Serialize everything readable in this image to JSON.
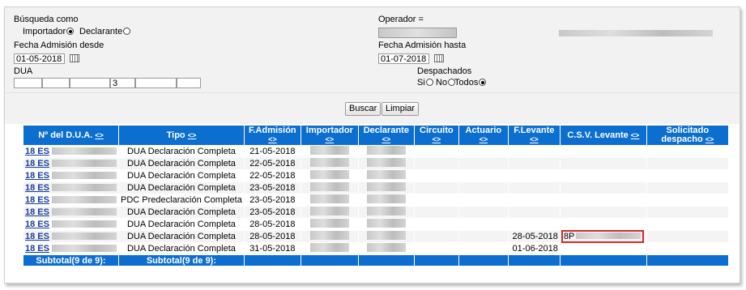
{
  "filters": {
    "busqueda_label": "Búsqueda como",
    "importador_label": "Importador",
    "declarante_label": "Declarante",
    "fecha_desde_label": "Fecha Admisión desde",
    "fecha_desde_value": "01-05-2018",
    "dua_label": "DUA",
    "dua_fields": [
      "",
      "",
      "",
      "3",
      "",
      ""
    ],
    "operador_label": "Operador =",
    "fecha_hasta_label": "Fecha Admisión hasta",
    "fecha_hasta_value": "01-07-2018",
    "despachados_label": "Despachados",
    "si_label": "Si",
    "no_label": "No",
    "todos_label": "Todos"
  },
  "buttons": {
    "buscar": "Buscar",
    "limpiar": "Limpiar"
  },
  "table": {
    "headers": [
      "Nº del D.U.A.",
      "Tipo",
      "F.Admisión",
      "Importador",
      "Declarante",
      "Circuito",
      "Actuario",
      "F.Levante",
      "C.S.V. Levante",
      "Solicitado despacho"
    ],
    "sort_symbol": "<>",
    "rows": [
      {
        "dua": "18 ES",
        "tipo": "DUA Declaración Completa",
        "fecha": "21-05-2018",
        "levante": "",
        "csv": ""
      },
      {
        "dua": "18 ES",
        "tipo": "DUA Declaración Completa",
        "fecha": "22-05-2018",
        "levante": "",
        "csv": ""
      },
      {
        "dua": "18 ES",
        "tipo": "DUA Declaración Completa",
        "fecha": "22-05-2018",
        "levante": "",
        "csv": ""
      },
      {
        "dua": "18 ES",
        "tipo": "DUA Declaración Completa",
        "fecha": "23-05-2018",
        "levante": "",
        "csv": ""
      },
      {
        "dua": "18 ES",
        "tipo": "PDC Predeclaración Completa",
        "fecha": "23-05-2018",
        "levante": "",
        "csv": ""
      },
      {
        "dua": "18 ES",
        "tipo": "DUA Declaración Completa",
        "fecha": "23-05-2018",
        "levante": "",
        "csv": ""
      },
      {
        "dua": "18 ES",
        "tipo": "DUA Declaración Completa",
        "fecha": "28-05-2018",
        "levante": "",
        "csv": ""
      },
      {
        "dua": "18 ES",
        "tipo": "DUA Declaración Completa",
        "fecha": "28-05-2018",
        "levante": "28-05-2018",
        "csv": "8P"
      },
      {
        "dua": "18 ES",
        "tipo": "DUA Declaración Completa",
        "fecha": "31-05-2018",
        "levante": "01-06-2018",
        "csv": ""
      }
    ],
    "subtotal": "Subtotal(9 de 9):"
  },
  "colors": {
    "header_bg": "#0c6fcf",
    "highlight": "#d62828",
    "link": "#1a3d9c"
  }
}
